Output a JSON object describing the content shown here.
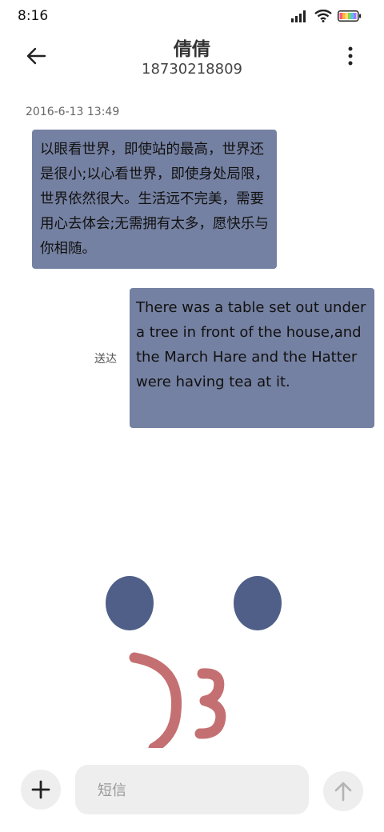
{
  "status_bar": {
    "time": "8:16",
    "battery_colors": [
      "#ff5a7a",
      "#ffb347",
      "#ffe066",
      "#7ed957",
      "#5bc0eb",
      "#9b7bff"
    ]
  },
  "header": {
    "name": "倩倩",
    "number": "18730218809"
  },
  "conversation": {
    "timestamp": "2016-6-13 13:49",
    "messages": [
      {
        "direction": "incoming",
        "text": "以眼看世界，即使站的最高，世界还是很小;以心看世界，即使身处局限，世界依然很大。生活远不完美，需要用心去体会;无需拥有太多，愿快乐与你相随。"
      },
      {
        "direction": "outgoing",
        "text": "There was a table set out under a tree in front of the house,and the March Hare and the Hatter were having tea at it.",
        "status": "送达"
      }
    ]
  },
  "input": {
    "placeholder": "短信"
  },
  "colors": {
    "bubble": "#7581a2",
    "eye": "#4f5f88",
    "mouth": "#c47072"
  }
}
